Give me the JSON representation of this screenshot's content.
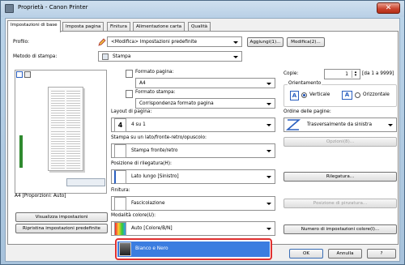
{
  "window": {
    "title": "Proprietà - Canon Printer",
    "close_glyph": "✕"
  },
  "tabs": [
    {
      "label": "Impostazioni di base"
    },
    {
      "label": "Imposta pagina"
    },
    {
      "label": "Finitura"
    },
    {
      "label": "Alimentazione carta"
    },
    {
      "label": "Qualità"
    }
  ],
  "profile": {
    "label": "Profilo:",
    "value": "<Modifica> Impostazioni predefinite",
    "add_button": "Aggiungi(1)...",
    "edit_button": "Modifica(2)..."
  },
  "output_method": {
    "label": "Metodo di stampa:",
    "value": "Stampa"
  },
  "preview": {
    "caption": "A4 [Proporzioni: Auto]"
  },
  "buttons_left": {
    "view_settings": "Visualizza impostazioni",
    "restore_defaults": "Ripristina impostazioni predefinite"
  },
  "page_size": {
    "label": "Formato pagina:",
    "value": "A4"
  },
  "output_size": {
    "label": "Formato stampa:",
    "value": "Corrispondenza formato pagina"
  },
  "copies": {
    "label": "Copie:",
    "value": "1",
    "range": "[da 1 a 9999]"
  },
  "orientation": {
    "label": "Orientamento",
    "portrait": "Verticale",
    "landscape": "Orizzontale"
  },
  "page_layout": {
    "label": "Layout di pagina:",
    "value": "4 su 1",
    "icon_text": "4"
  },
  "page_order": {
    "label": "Ordine delle pagine:",
    "value": "Trasversalmente da sinistra",
    "options_button": "Opzioni(8)..."
  },
  "duplex": {
    "label": "Stampa su un lato/fronte-retro/opuscolo:",
    "value": "Stampa fronte/retro"
  },
  "binding": {
    "label": "Posizione di rilegatura(H):",
    "value": "Lato lungo [Sinistro]",
    "button": "Rilegatura..."
  },
  "finishing": {
    "label": "Finitura:",
    "value": "Fascicolazione",
    "staple_button": "Posizione di pinzatura..."
  },
  "color_mode": {
    "label": "Modalità colore(U):",
    "value": "Auto [Colore/B/N]",
    "dropdown_option": "Bianco e Nero",
    "copy_sets_button": "Numero di impostazioni colore(I)..."
  },
  "footer": {
    "ok": "OK",
    "cancel": "Annulla",
    "help": "?"
  }
}
